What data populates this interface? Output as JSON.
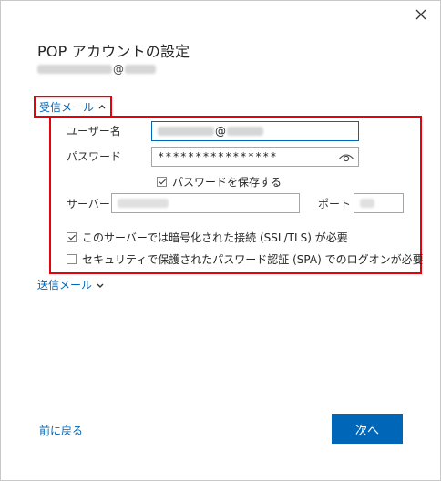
{
  "dialog": {
    "title": "POP アカウントの設定",
    "email_at": "@"
  },
  "incoming": {
    "toggle_label": "受信メール",
    "username_label": "ユーザー名",
    "username_at": "@",
    "password_label": "パスワード",
    "password_value": "****************",
    "save_password_label": "パスワードを保存する",
    "save_password_checked": true,
    "server_label": "サーバー",
    "port_label": "ポート",
    "ssl_label": "このサーバーでは暗号化された接続 (SSL/TLS) が必要",
    "ssl_checked": true,
    "spa_label": "セキュリティで保護されたパスワード認証 (SPA) でのログオンが必要",
    "spa_checked": false
  },
  "outgoing": {
    "toggle_label": "送信メール"
  },
  "footer": {
    "back_label": "前に戻る",
    "next_label": "次へ"
  },
  "colors": {
    "accent": "#0067b8",
    "highlight": "#e8000b"
  }
}
